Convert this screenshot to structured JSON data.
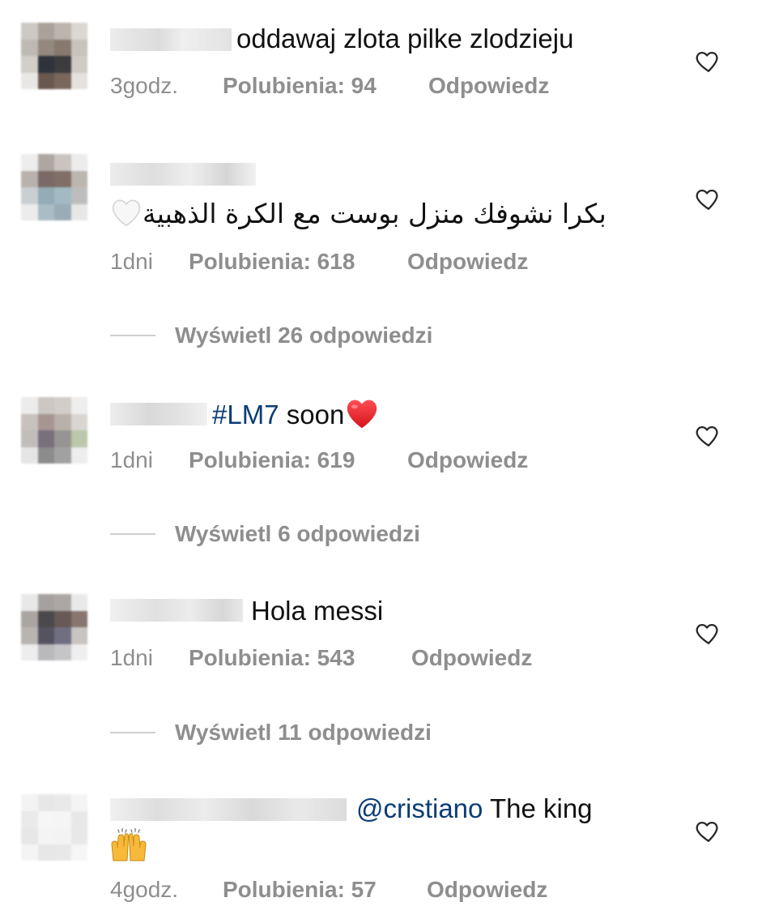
{
  "comments": [
    {
      "text": "oddawaj zlota pilke zlodzieju",
      "time": "3godz.",
      "likes": "Polubienia: 94",
      "reply": "Odpowiedz"
    },
    {
      "text": "بكرا نشوفك منزل بوست مع الكرة الذهبية",
      "emoji": "white-heart",
      "time": "1dni",
      "likes": "Polubienia: 618",
      "reply": "Odpowiedz",
      "view_replies": "Wyświetl 26 odpowiedzi"
    },
    {
      "tag": "#LM7",
      "text": "soon",
      "emoji": "red-heart",
      "time": "1dni",
      "likes": "Polubienia: 619",
      "reply": "Odpowiedz",
      "view_replies": "Wyświetl 6 odpowiedzi"
    },
    {
      "text": "Hola messi",
      "time": "1dni",
      "likes": "Polubienia: 543",
      "reply": "Odpowiedz",
      "view_replies": "Wyświetl 11 odpowiedzi"
    },
    {
      "mention": "@cristiano",
      "text": "The king",
      "emoji": "raised-hands",
      "time": "4godz.",
      "likes": "Polubienia: 57",
      "reply": "Odpowiedz"
    }
  ],
  "colors": {
    "meta": "#8e8e8e",
    "link": "#0b3d74",
    "heart": "#262626",
    "red_heart": "#e0262e"
  }
}
